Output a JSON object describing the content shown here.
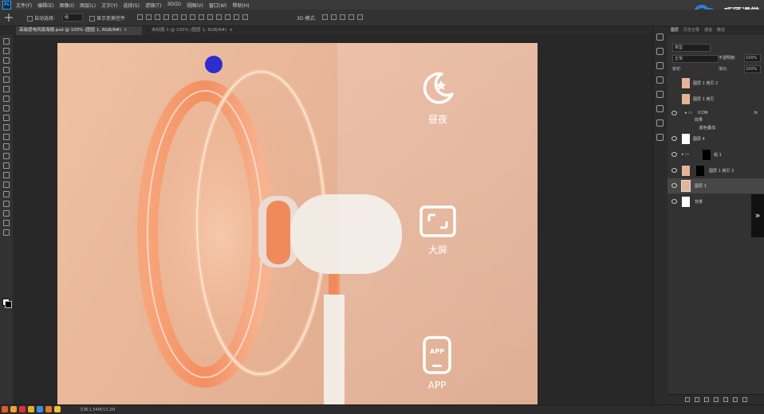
{
  "menubar": {
    "logo": "Ps",
    "items": [
      "文件(F)",
      "编辑(E)",
      "图像(I)",
      "图层(L)",
      "文字(Y)",
      "选择(S)",
      "滤镜(T)",
      "3D(D)",
      "视图(V)",
      "窗口(W)",
      "帮助(H)"
    ]
  },
  "options": {
    "auto_select_label": "自动选择:",
    "auto_select_value": "组",
    "transform_label": "显示变换控件",
    "mode_3d_label": "3D 模式:"
  },
  "tabs": [
    {
      "label": "高级感电风扇海报.psd @ 100% (图层 1, RGB/8#)"
    },
    {
      "label": "未标题-1 @ 100% (图层 1, RGB/8#)"
    }
  ],
  "canvas": {
    "colors": {
      "bg_top": "#efc1a2",
      "bg_bottom": "#dca88c",
      "frost": "#ffffff",
      "accent": "#f08a5d"
    },
    "features": [
      {
        "icon": "moon-star-icon",
        "label": "昼夜"
      },
      {
        "icon": "fullscreen-frame-icon",
        "label": "大屏"
      },
      {
        "icon": "phone-app-icon",
        "label": "APP"
      }
    ]
  },
  "watermark": {
    "text": "巧匠课堂"
  },
  "layers_panel": {
    "tabs": [
      "图层",
      "历史记录",
      "通道",
      "路径"
    ],
    "filter": "类型",
    "blend_mode": "正常",
    "opacity_label": "不透明度:",
    "opacity_value": "100%",
    "lock_label": "锁定:",
    "fill_label": "填充:",
    "fill_value": "100%",
    "rows": [
      {
        "name": "图层 1 拷贝 2",
        "thumb": "#e6b396",
        "selected": false,
        "fx": false
      },
      {
        "name": "图层 1 拷贝",
        "thumb": "#e6b396",
        "selected": false,
        "fx": false
      },
      {
        "name": "ICON",
        "thumb": "#3a3a3a",
        "selected": false,
        "fx": true
      },
      {
        "name": "效果",
        "thumb": "",
        "selected": false,
        "fx": false
      },
      {
        "name": "颜色叠加",
        "thumb": "",
        "selected": false,
        "fx": false
      },
      {
        "name": "图层 4",
        "thumb": "#ffffff",
        "selected": false,
        "fx": false
      },
      {
        "name": "组 1",
        "thumb": "#000000",
        "selected": false,
        "fx": false
      },
      {
        "name": "图层 1 拷贝 3",
        "thumb": "#e6b396",
        "selected": false,
        "fx": false
      },
      {
        "name": "图层 1",
        "thumb": "#e6b396",
        "selected": true,
        "fx": false
      },
      {
        "name": "背景",
        "thumb": "#ffffff",
        "selected": false,
        "fx": false
      }
    ]
  },
  "status": {
    "text": "文档:1.54M/13.2M"
  }
}
